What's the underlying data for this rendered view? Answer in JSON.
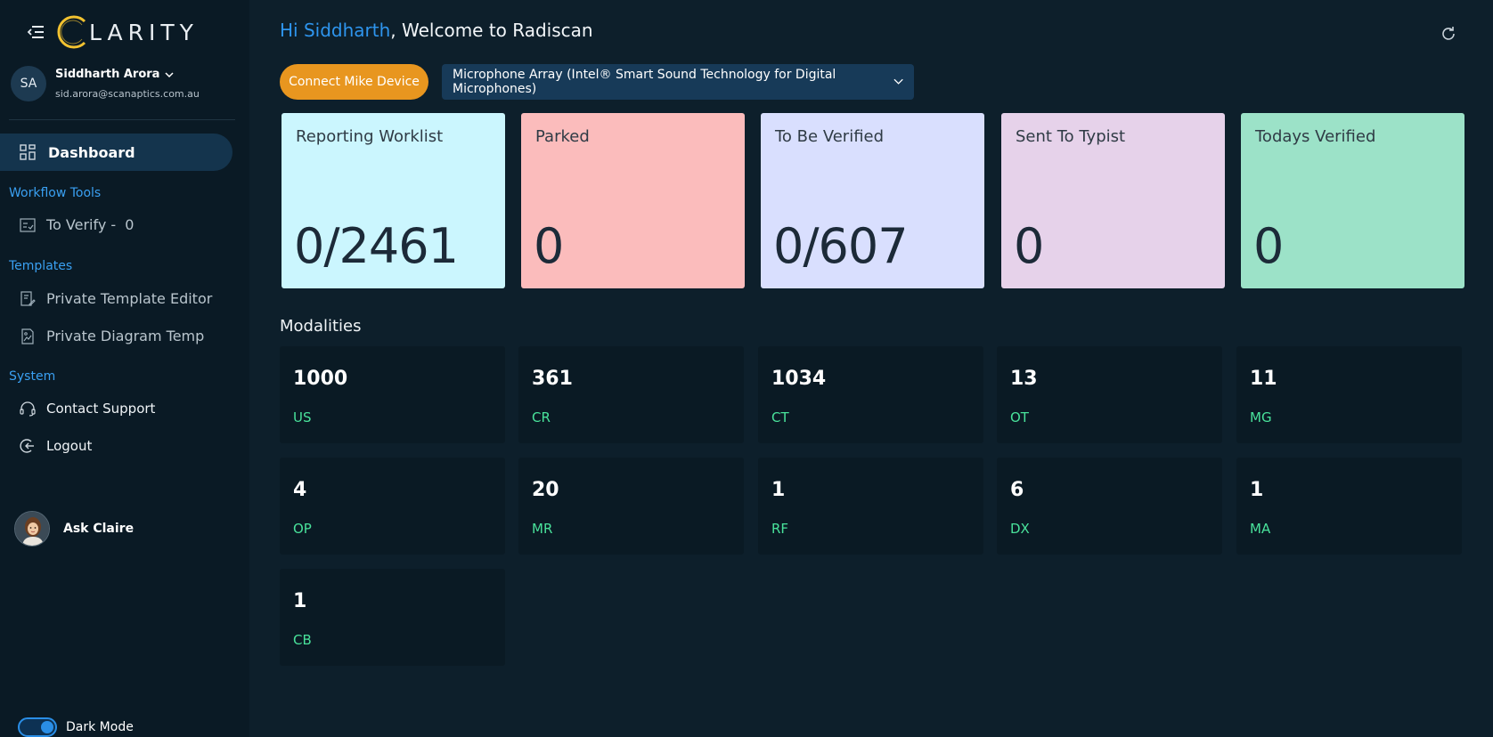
{
  "app": {
    "logo_text": "LARITY",
    "logo_letter": "C"
  },
  "user": {
    "initials": "SA",
    "name": "Siddharth Arora",
    "email": "sid.arora@scanaptics.com.au"
  },
  "nav": {
    "dashboard": "Dashboard",
    "sections": {
      "workflow": "Workflow Tools",
      "templates": "Templates",
      "system": "System"
    },
    "to_verify": {
      "label": "To Verify -",
      "count": "0"
    },
    "private_template_editor": "Private Template Editor",
    "private_diagram_temp": "Private Diagram Temp",
    "contact_support": "Contact Support",
    "logout": "Logout",
    "ask_claire": "Ask Claire",
    "dark_mode": "Dark Mode"
  },
  "header": {
    "greeting_name": "Hi Siddharth",
    "greeting_rest": ", Welcome to Radiscan",
    "connect_button": "Connect Mike Device",
    "mic_selected": "Microphone Array (Intel® Smart Sound Technology for Digital Microphones)"
  },
  "cards": [
    {
      "title": "Reporting Worklist",
      "value": "0/2461",
      "color": "#cbf6fe"
    },
    {
      "title": "Parked",
      "value": "0",
      "color": "#fbbcbc"
    },
    {
      "title": "To Be Verified",
      "value": "0/607",
      "color": "#d9dffe"
    },
    {
      "title": "Sent To Typist",
      "value": "0",
      "color": "#e6d2ea"
    },
    {
      "title": "Todays Verified",
      "value": "0",
      "color": "#9ce2c8"
    }
  ],
  "modalities_title": "Modalities",
  "modalities": [
    {
      "count": "1000",
      "code": "US"
    },
    {
      "count": "361",
      "code": "CR"
    },
    {
      "count": "1034",
      "code": "CT"
    },
    {
      "count": "13",
      "code": "OT"
    },
    {
      "count": "11",
      "code": "MG"
    },
    {
      "count": "4",
      "code": "OP"
    },
    {
      "count": "20",
      "code": "MR"
    },
    {
      "count": "1",
      "code": "RF"
    },
    {
      "count": "6",
      "code": "DX"
    },
    {
      "count": "1",
      "code": "MA"
    },
    {
      "count": "1",
      "code": "CB"
    }
  ],
  "colors": {
    "accent": "#2e95ee",
    "orange": "#e8961f",
    "green": "#49e29b"
  }
}
